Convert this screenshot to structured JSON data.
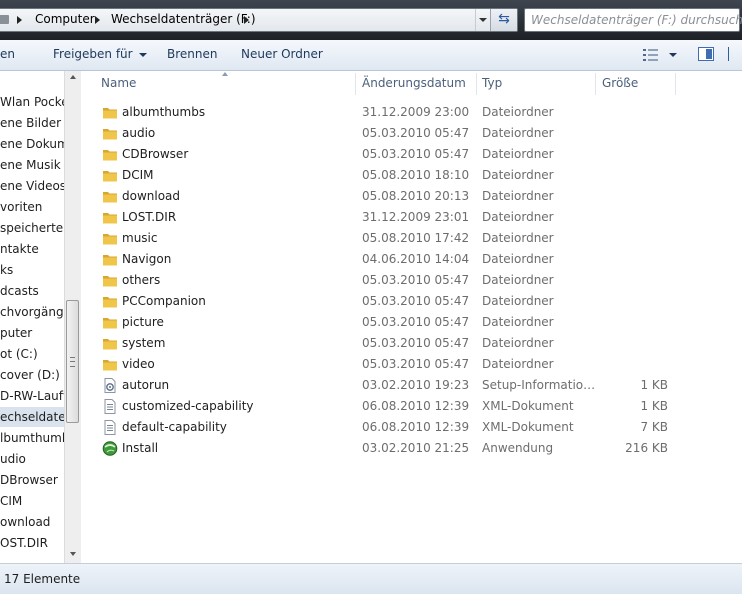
{
  "address_bar": {
    "breadcrumbs": [
      "Computer",
      "Wechseldatenträger (F:)"
    ],
    "search_placeholder": "Wechseldatenträger (F:) durchsuchen"
  },
  "toolbar": {
    "organize_partial": "en",
    "share_label": "Freigeben für",
    "burn_label": "Brennen",
    "new_folder_label": "Neuer Ordner"
  },
  "columns": {
    "name": "Name",
    "date": "Änderungsdatum",
    "type": "Typ",
    "size": "Größe"
  },
  "navigation": {
    "items": [
      "Wlan Pocket",
      "ene Bilder",
      "ene Dokume",
      "ene Musik",
      "ene Videos",
      "voriten",
      "speicherte S",
      "ntakte",
      "ks",
      "dcasts",
      "chvorgänge",
      "puter",
      "ot (C:)",
      "cover (D:)",
      "D-RW-Laufv",
      "echseldatent",
      "lbumthumb",
      "udio",
      "DBrowser",
      "CIM",
      "ownload",
      "OST.DIR"
    ],
    "selected_index": 15
  },
  "files": [
    {
      "name": "albumthumbs",
      "date": "31.12.2009 23:00",
      "type": "Dateiordner",
      "size": "",
      "icon": "folder-icon"
    },
    {
      "name": "audio",
      "date": "05.03.2010 05:47",
      "type": "Dateiordner",
      "size": "",
      "icon": "folder-icon"
    },
    {
      "name": "CDBrowser",
      "date": "05.03.2010 05:47",
      "type": "Dateiordner",
      "size": "",
      "icon": "folder-icon"
    },
    {
      "name": "DCIM",
      "date": "05.08.2010 18:10",
      "type": "Dateiordner",
      "size": "",
      "icon": "folder-icon"
    },
    {
      "name": "download",
      "date": "05.08.2010 20:13",
      "type": "Dateiordner",
      "size": "",
      "icon": "folder-icon"
    },
    {
      "name": "LOST.DIR",
      "date": "31.12.2009 23:01",
      "type": "Dateiordner",
      "size": "",
      "icon": "folder-icon"
    },
    {
      "name": "music",
      "date": "05.08.2010 17:42",
      "type": "Dateiordner",
      "size": "",
      "icon": "folder-icon"
    },
    {
      "name": "Navigon",
      "date": "04.06.2010 14:04",
      "type": "Dateiordner",
      "size": "",
      "icon": "folder-icon"
    },
    {
      "name": "others",
      "date": "05.03.2010 05:47",
      "type": "Dateiordner",
      "size": "",
      "icon": "folder-icon"
    },
    {
      "name": "PCCompanion",
      "date": "05.03.2010 05:47",
      "type": "Dateiordner",
      "size": "",
      "icon": "folder-icon"
    },
    {
      "name": "picture",
      "date": "05.03.2010 05:47",
      "type": "Dateiordner",
      "size": "",
      "icon": "folder-icon"
    },
    {
      "name": "system",
      "date": "05.03.2010 05:47",
      "type": "Dateiordner",
      "size": "",
      "icon": "folder-icon"
    },
    {
      "name": "video",
      "date": "05.03.2010 05:47",
      "type": "Dateiordner",
      "size": "",
      "icon": "folder-icon"
    },
    {
      "name": "autorun",
      "date": "03.02.2010 19:23",
      "type": "Setup-Informatio…",
      "size": "1 KB",
      "icon": "setup-info-icon"
    },
    {
      "name": "customized-capability",
      "date": "06.08.2010 12:39",
      "type": "XML-Dokument",
      "size": "1 KB",
      "icon": "xml-document-icon"
    },
    {
      "name": "default-capability",
      "date": "06.08.2010 12:39",
      "type": "XML-Dokument",
      "size": "7 KB",
      "icon": "xml-document-icon"
    },
    {
      "name": "Install",
      "date": "03.02.2010 21:25",
      "type": "Anwendung",
      "size": "216 KB",
      "icon": "application-icon"
    }
  ],
  "status": {
    "item_count": "17 Elemente"
  },
  "colors": {
    "folder": "#f0c64a",
    "folder_dark": "#d9a730",
    "header_text": "#4c607a",
    "selected_nav": "#d9e3ee"
  }
}
